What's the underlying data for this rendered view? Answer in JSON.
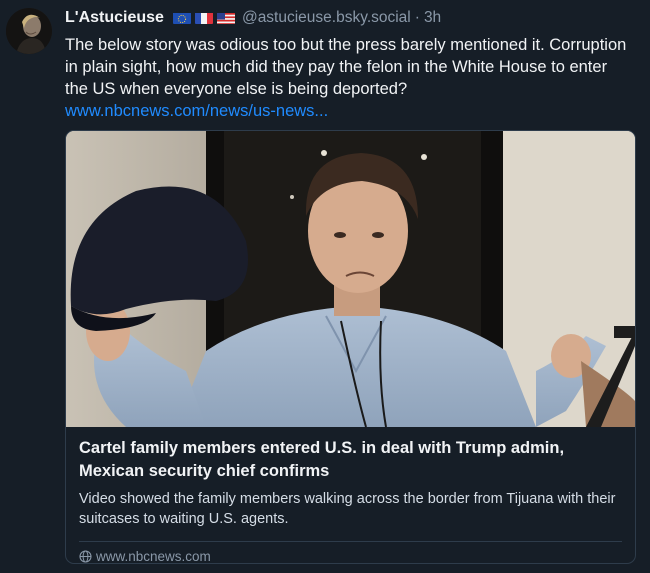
{
  "post": {
    "author": {
      "display_name": "L'Astucieuse",
      "flags": [
        "eu-flag-icon",
        "france-flag-icon",
        "us-flag-icon"
      ],
      "handle": "@astucieuse.bsky.social",
      "separator": "·",
      "time": "3h"
    },
    "text": "The below story was odious too but the press barely mentioned it. Corruption in plain sight, how much did they pay the felon in the White House to enter the US when everyone else is being deported?",
    "link": "www.nbcnews.com/news/us-news..."
  },
  "card": {
    "title": "Cartel family members entered U.S. in deal with Trump admin, Mexican security chief confirms",
    "description": "Video showed the family members walking across the border from Tijuana with their suitcases to waiting U.S. agents.",
    "domain": "www.nbcnews.com",
    "domain_icon": "globe-icon"
  },
  "colors": {
    "background": "#161e27",
    "link": "#208bfe",
    "muted": "#8a98a8",
    "border": "#2e3c4b"
  }
}
